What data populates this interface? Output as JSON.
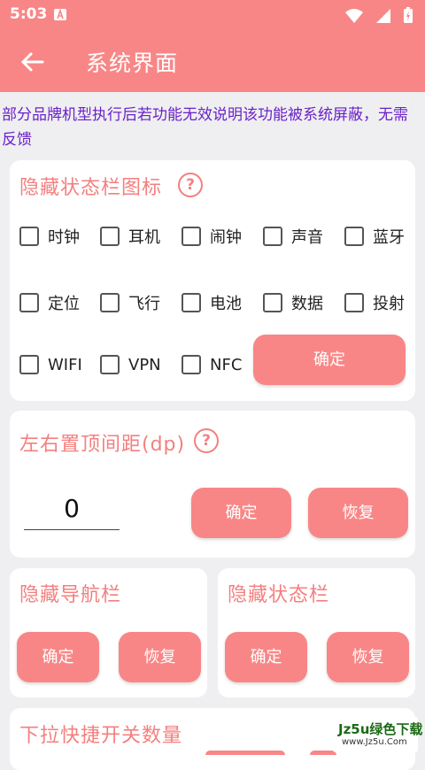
{
  "status_bar": {
    "time": "5:03"
  },
  "app_bar": {
    "title": "系统界面"
  },
  "notice": "部分品牌机型执行后若功能无效说明该功能被系统屏蔽，无需反馈",
  "hide_status_icons": {
    "title": "隐藏状态栏图标",
    "help": "?",
    "options": [
      "时钟",
      "耳机",
      "闹钟",
      "声音",
      "蓝牙",
      "定位",
      "飞行",
      "电池",
      "数据",
      "投射",
      "WIFI",
      "VPN",
      "NFC"
    ],
    "confirm_label": "确定"
  },
  "top_margin": {
    "title": "左右置顶间距(dp)",
    "help": "?",
    "value": "0",
    "confirm_label": "确定",
    "restore_label": "恢复"
  },
  "hide_nav_bar": {
    "title": "隐藏导航栏",
    "confirm_label": "确定",
    "restore_label": "恢复"
  },
  "hide_status_bar": {
    "title": "隐藏状态栏",
    "confirm_label": "确定",
    "restore_label": "恢复"
  },
  "quick_switch": {
    "title": "下拉快捷开关数量"
  },
  "watermark": {
    "line1": "Jz5u绿色下载",
    "line2": "www.Jz5u.Com"
  },
  "colors": {
    "accent": "#f98686",
    "card_title": "#f47f7f",
    "notice": "#6a22c9",
    "background": "#efeff1"
  }
}
